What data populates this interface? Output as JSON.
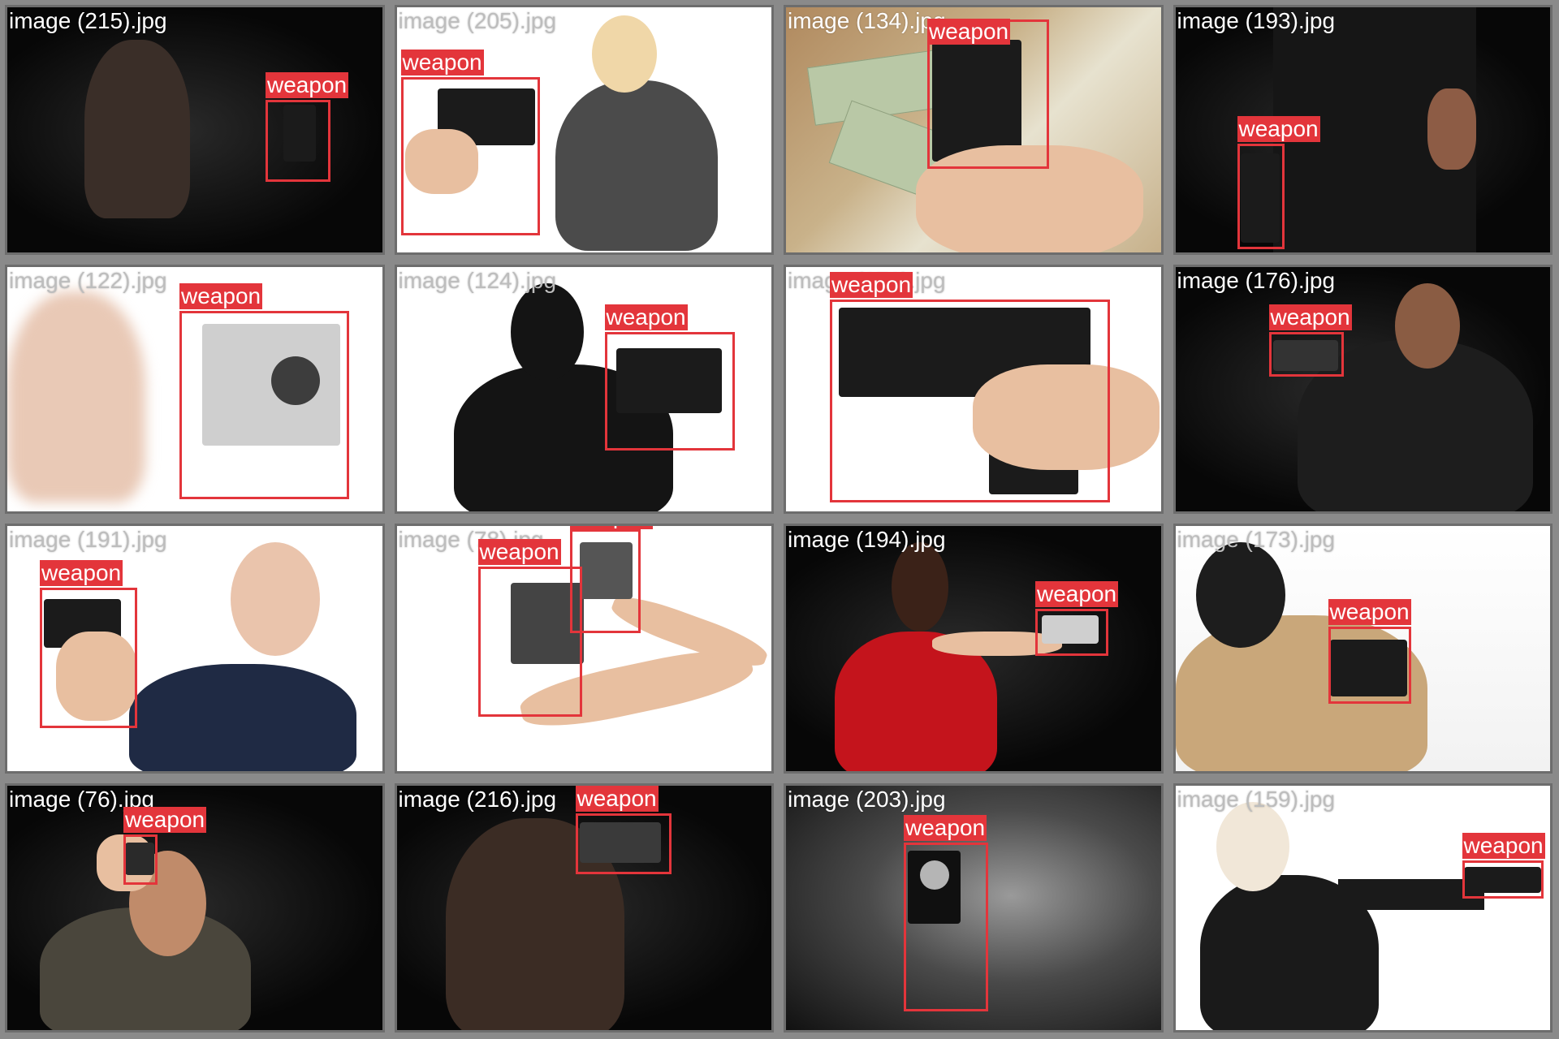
{
  "label_text": "weapon",
  "colors": {
    "bbox": "#e3353b",
    "frame": "#6d6d6d",
    "background": "#8a8a8a"
  },
  "tiles": [
    {
      "caption": "image (215).jpg",
      "theme": "dark"
    },
    {
      "caption": "image (205).jpg",
      "theme": "light"
    },
    {
      "caption": "image (134).jpg",
      "theme": "wood"
    },
    {
      "caption": "image (193).jpg",
      "theme": "dark"
    },
    {
      "caption": "image (122).jpg",
      "theme": "light"
    },
    {
      "caption": "image (124).jpg",
      "theme": "light"
    },
    {
      "caption": "image (171).jpg",
      "theme": "light"
    },
    {
      "caption": "image (176).jpg",
      "theme": "dark"
    },
    {
      "caption": "image (191).jpg",
      "theme": "light"
    },
    {
      "caption": "image (78).jpg",
      "theme": "light"
    },
    {
      "caption": "image (194).jpg",
      "theme": "dark"
    },
    {
      "caption": "image (173).jpg",
      "theme": "studio"
    },
    {
      "caption": "image (76).jpg",
      "theme": "dark"
    },
    {
      "caption": "image (216).jpg",
      "theme": "dark"
    },
    {
      "caption": "image (203).jpg",
      "theme": "blur"
    },
    {
      "caption": "image (159).jpg",
      "theme": "light"
    }
  ]
}
